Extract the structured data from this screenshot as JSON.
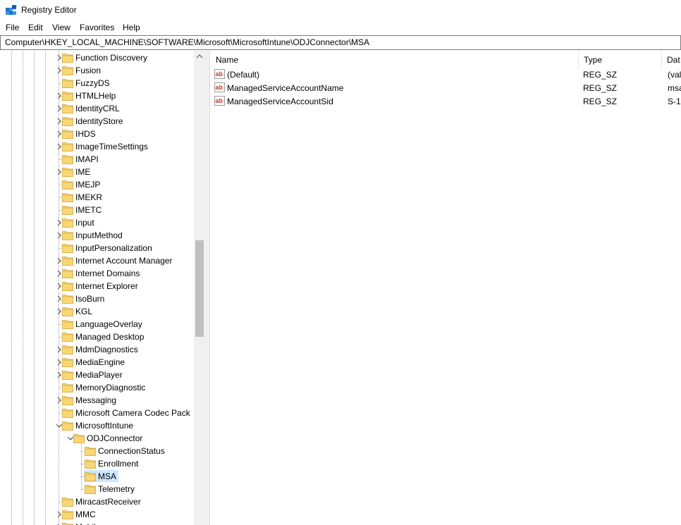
{
  "window": {
    "title": "Registry Editor"
  },
  "menu": [
    "File",
    "Edit",
    "View",
    "Favorites",
    "Help"
  ],
  "address": "Computer\\HKEY_LOCAL_MACHINE\\SOFTWARE\\Microsoft\\MicrosoftIntune\\ODJConnector\\MSA",
  "tree": [
    {
      "label": "Function Discovery",
      "level": 0,
      "expander": "collapsed"
    },
    {
      "label": "Fusion",
      "level": 0,
      "expander": "collapsed"
    },
    {
      "label": "FuzzyDS",
      "level": 0,
      "expander": "none"
    },
    {
      "label": "HTMLHelp",
      "level": 0,
      "expander": "collapsed"
    },
    {
      "label": "IdentityCRL",
      "level": 0,
      "expander": "collapsed"
    },
    {
      "label": "IdentityStore",
      "level": 0,
      "expander": "collapsed"
    },
    {
      "label": "IHDS",
      "level": 0,
      "expander": "collapsed"
    },
    {
      "label": "ImageTimeSettings",
      "level": 0,
      "expander": "collapsed"
    },
    {
      "label": "IMAPI",
      "level": 0,
      "expander": "none"
    },
    {
      "label": "IME",
      "level": 0,
      "expander": "collapsed"
    },
    {
      "label": "IMEJP",
      "level": 0,
      "expander": "none"
    },
    {
      "label": "IMEKR",
      "level": 0,
      "expander": "none"
    },
    {
      "label": "IMETC",
      "level": 0,
      "expander": "none"
    },
    {
      "label": "Input",
      "level": 0,
      "expander": "collapsed"
    },
    {
      "label": "InputMethod",
      "level": 0,
      "expander": "collapsed"
    },
    {
      "label": "InputPersonalization",
      "level": 0,
      "expander": "none"
    },
    {
      "label": "Internet Account Manager",
      "level": 0,
      "expander": "collapsed"
    },
    {
      "label": "Internet Domains",
      "level": 0,
      "expander": "collapsed"
    },
    {
      "label": "Internet Explorer",
      "level": 0,
      "expander": "collapsed"
    },
    {
      "label": "IsoBurn",
      "level": 0,
      "expander": "collapsed"
    },
    {
      "label": "KGL",
      "level": 0,
      "expander": "collapsed"
    },
    {
      "label": "LanguageOverlay",
      "level": 0,
      "expander": "none"
    },
    {
      "label": "Managed Desktop",
      "level": 0,
      "expander": "none"
    },
    {
      "label": "MdmDiagnostics",
      "level": 0,
      "expander": "collapsed"
    },
    {
      "label": "MediaEngine",
      "level": 0,
      "expander": "collapsed"
    },
    {
      "label": "MediaPlayer",
      "level": 0,
      "expander": "collapsed"
    },
    {
      "label": "MemoryDiagnostic",
      "level": 0,
      "expander": "none"
    },
    {
      "label": "Messaging",
      "level": 0,
      "expander": "collapsed"
    },
    {
      "label": "Microsoft Camera Codec Pack",
      "level": 0,
      "expander": "none"
    },
    {
      "label": "MicrosoftIntune",
      "level": 0,
      "expander": "expanded"
    },
    {
      "label": "ODJConnector",
      "level": 1,
      "expander": "expanded"
    },
    {
      "label": "ConnectionStatus",
      "level": 2,
      "expander": "none"
    },
    {
      "label": "Enrollment",
      "level": 2,
      "expander": "none"
    },
    {
      "label": "MSA",
      "level": 2,
      "expander": "none",
      "selected": true
    },
    {
      "label": "Telemetry",
      "level": 2,
      "expander": "none"
    },
    {
      "label": "MiracastReceiver",
      "level": 0,
      "expander": "none"
    },
    {
      "label": "MMC",
      "level": 0,
      "expander": "collapsed"
    },
    {
      "label": "Mobile",
      "level": 0,
      "expander": "collapsed"
    }
  ],
  "columns": [
    "Name",
    "Type",
    "Dat"
  ],
  "values": [
    {
      "name": "(Default)",
      "type": "REG_SZ",
      "data": "(val"
    },
    {
      "name": "ManagedServiceAccountName",
      "type": "REG_SZ",
      "data": "msa"
    },
    {
      "name": "ManagedServiceAccountSid",
      "type": "REG_SZ",
      "data": "S-1-"
    }
  ],
  "colors": {
    "folder": "#f8d775",
    "folder_edge": "#dcb251",
    "selection": "#cce8ff",
    "reg_sz_icon": "#c0392b"
  }
}
